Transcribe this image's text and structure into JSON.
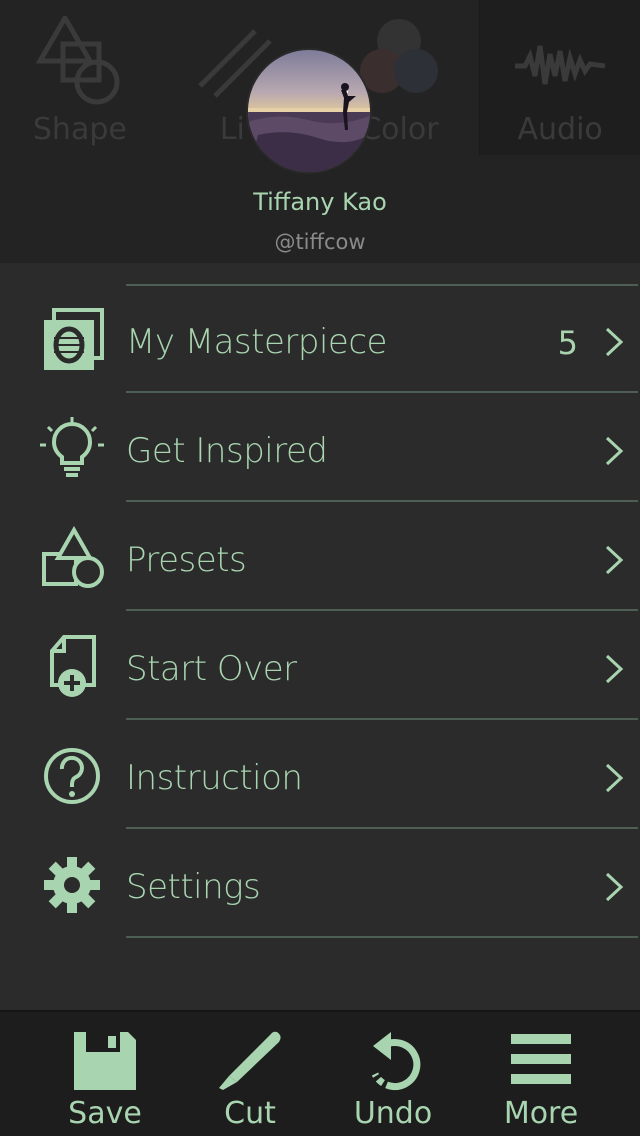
{
  "background_toolbar": {
    "tools": [
      {
        "label": "Shape",
        "icon": "shape-icon"
      },
      {
        "label": "Li",
        "icon": "line-icon"
      },
      {
        "label": "Color",
        "icon": "color-icon"
      },
      {
        "label": "Audio",
        "icon": "audio-waveform-icon"
      }
    ]
  },
  "profile": {
    "name": "Tiffany Kao",
    "handle": "@tiffcow"
  },
  "menu": {
    "items": [
      {
        "label": "My Masterpiece",
        "count": "5",
        "icon": "masterpiece-icon"
      },
      {
        "label": "Get Inspired",
        "icon": "lightbulb-icon"
      },
      {
        "label": "Presets",
        "icon": "presets-shapes-icon"
      },
      {
        "label": "Start Over",
        "icon": "new-document-icon"
      },
      {
        "label": "Instruction",
        "icon": "help-circle-icon"
      },
      {
        "label": "Settings",
        "icon": "gear-icon"
      }
    ]
  },
  "bottom_bar": {
    "save": "Save",
    "cut": "Cut",
    "undo": "Undo",
    "more": "More"
  },
  "colors": {
    "accent": "#a8d5b0",
    "background": "#2b2b2b",
    "header": "#232323",
    "bottom_bar": "#1d1d1d",
    "divider": "#4d5f55"
  }
}
